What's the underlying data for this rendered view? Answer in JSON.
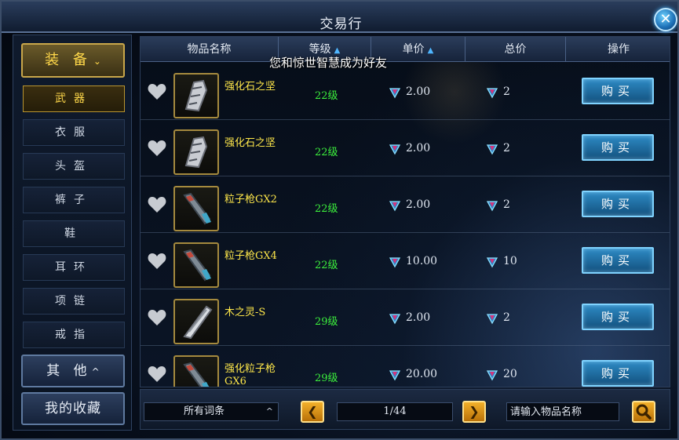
{
  "window": {
    "title": "交易行",
    "close_icon": "close-icon"
  },
  "sidebar": {
    "category": {
      "label": "装 备",
      "chevron": "⌄"
    },
    "items": [
      {
        "label": "武器",
        "active": true
      },
      {
        "label": "衣服",
        "active": false
      },
      {
        "label": "头盔",
        "active": false
      },
      {
        "label": "裤子",
        "active": false
      },
      {
        "label": "鞋",
        "active": false
      },
      {
        "label": "耳环",
        "active": false
      },
      {
        "label": "项链",
        "active": false
      },
      {
        "label": "戒指",
        "active": false
      }
    ],
    "other": {
      "label": "其 他",
      "chevron": "^"
    },
    "favorites": {
      "label": "我的收藏"
    }
  },
  "table": {
    "columns": [
      {
        "label": "物品名称"
      },
      {
        "label": "等级",
        "sort": "asc"
      },
      {
        "label": "单价",
        "sort": "asc"
      },
      {
        "label": "总价"
      },
      {
        "label": "操作"
      }
    ],
    "rows": [
      {
        "name": "强化石之坚",
        "level": "22级",
        "unit_price": "2.00",
        "total": "2",
        "buy_label": "购买",
        "icon": "stone-icon"
      },
      {
        "name": "强化石之坚",
        "level": "22级",
        "unit_price": "2.00",
        "total": "2",
        "buy_label": "购买",
        "icon": "stone-icon"
      },
      {
        "name": "粒子枪GX2",
        "level": "22级",
        "unit_price": "2.00",
        "total": "2",
        "buy_label": "购买",
        "icon": "gun-icon"
      },
      {
        "name": "粒子枪GX4",
        "level": "22级",
        "unit_price": "10.00",
        "total": "10",
        "buy_label": "购买",
        "icon": "gun-icon"
      },
      {
        "name": "木之灵-S",
        "level": "29级",
        "unit_price": "2.00",
        "total": "2",
        "buy_label": "购买",
        "icon": "blade-icon"
      },
      {
        "name": "强化粒子枪GX6",
        "level": "29级",
        "unit_price": "20.00",
        "total": "20",
        "buy_label": "购买",
        "icon": "gun-icon"
      }
    ]
  },
  "notice": "您和惊世智慧成为好友",
  "bottom": {
    "filter": "所有词条",
    "page": "1/44",
    "search_placeholder": "请输入物品名称"
  },
  "colors": {
    "gold": "#ffd84a",
    "level_green": "#3cef3c",
    "accent_blue": "#4fb6ff"
  }
}
